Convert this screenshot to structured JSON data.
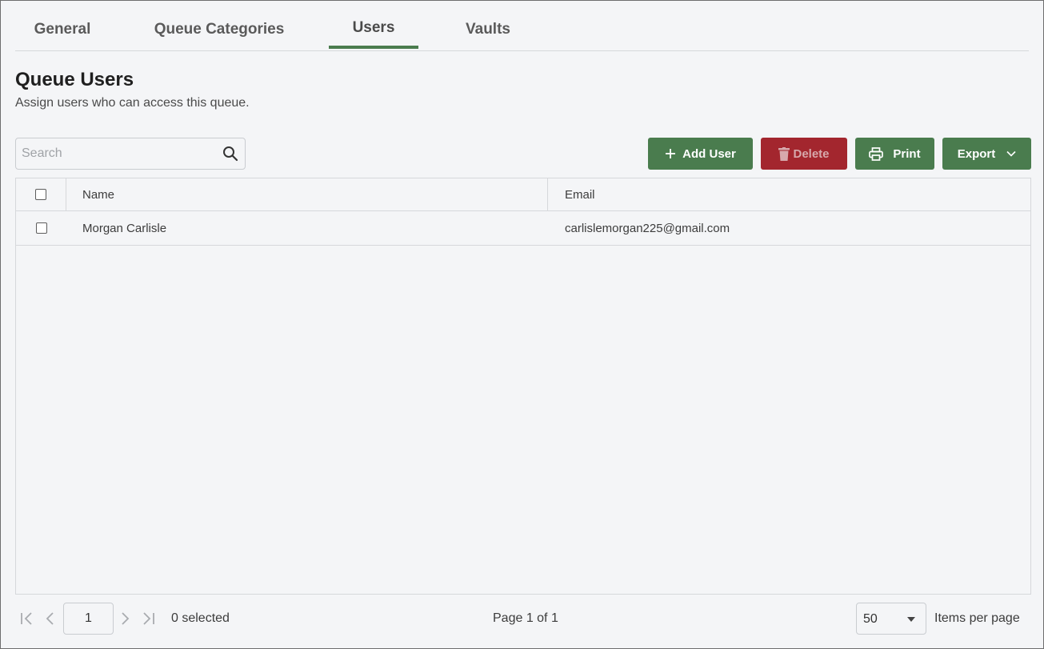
{
  "tabs": [
    {
      "label": "General",
      "active": false
    },
    {
      "label": "Queue Categories",
      "active": false
    },
    {
      "label": "Users",
      "active": true
    },
    {
      "label": "Vaults",
      "active": false
    }
  ],
  "header": {
    "title": "Queue Users",
    "subtitle": "Assign users who can access this queue."
  },
  "search": {
    "placeholder": "Search",
    "value": ""
  },
  "toolbar": {
    "add_user_label": "Add User",
    "delete_label": "Delete",
    "print_label": "Print",
    "export_label": "Export"
  },
  "table": {
    "columns": [
      "Name",
      "Email"
    ],
    "rows": [
      {
        "name": "Morgan Carlisle",
        "email": "carlislemorgan225@gmail.com",
        "checked": false
      }
    ]
  },
  "footer": {
    "current_page": "1",
    "selected_text": "0 selected",
    "page_info": "Page 1 of 1",
    "per_page_value": "50",
    "per_page_label": "Items per page"
  },
  "colors": {
    "accent_green": "#4a7c4e",
    "danger_red": "#a3262e",
    "background": "#f4f5f7"
  },
  "icons": {
    "search": "search-icon",
    "add": "plus-icon",
    "delete": "trash-icon",
    "print": "printer-icon",
    "export": "chevron-down-icon",
    "first_page": "first-page-icon",
    "prev_page": "prev-page-icon",
    "next_page": "next-page-icon",
    "last_page": "last-page-icon"
  }
}
